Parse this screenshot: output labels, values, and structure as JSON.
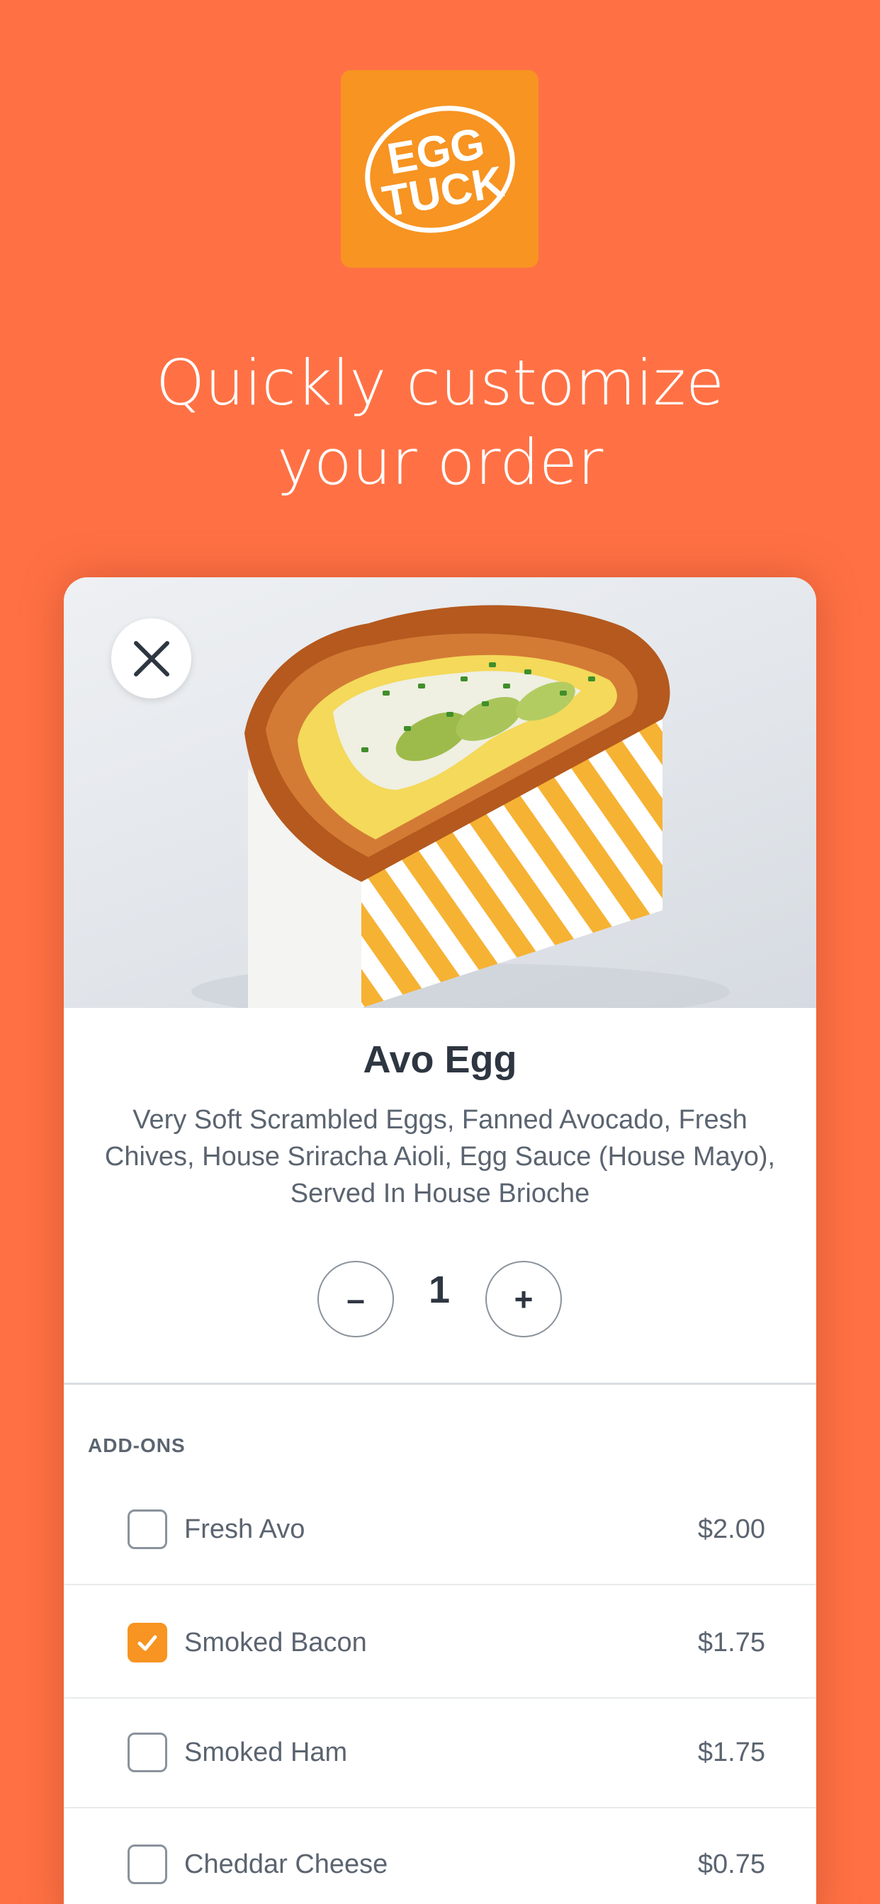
{
  "brand": {
    "logo_line1": "EGG",
    "logo_line2": "TUCK",
    "logo_color": "#F79422",
    "background_color": "#FF7145"
  },
  "headline": {
    "line1": "Quickly customize",
    "line2": "your order"
  },
  "item": {
    "close_icon": "close-icon",
    "name": "Avo Egg",
    "description": "Very Soft Scrambled Eggs, Fanned Avocado, Fresh Chives, House Sriracha Aioli, Egg Sauce (House Mayo), Served In House Brioche",
    "quantity": "1",
    "decrement_label": "–",
    "increment_label": "+"
  },
  "addons": {
    "title": "ADD-ONS",
    "items": [
      {
        "name": "Fresh Avo",
        "price": "$2.00",
        "checked": false
      },
      {
        "name": "Smoked Bacon",
        "price": "$1.75",
        "checked": true
      },
      {
        "name": "Smoked Ham",
        "price": "$1.75",
        "checked": false
      },
      {
        "name": "Cheddar Cheese",
        "price": "$0.75",
        "checked": false
      }
    ]
  }
}
